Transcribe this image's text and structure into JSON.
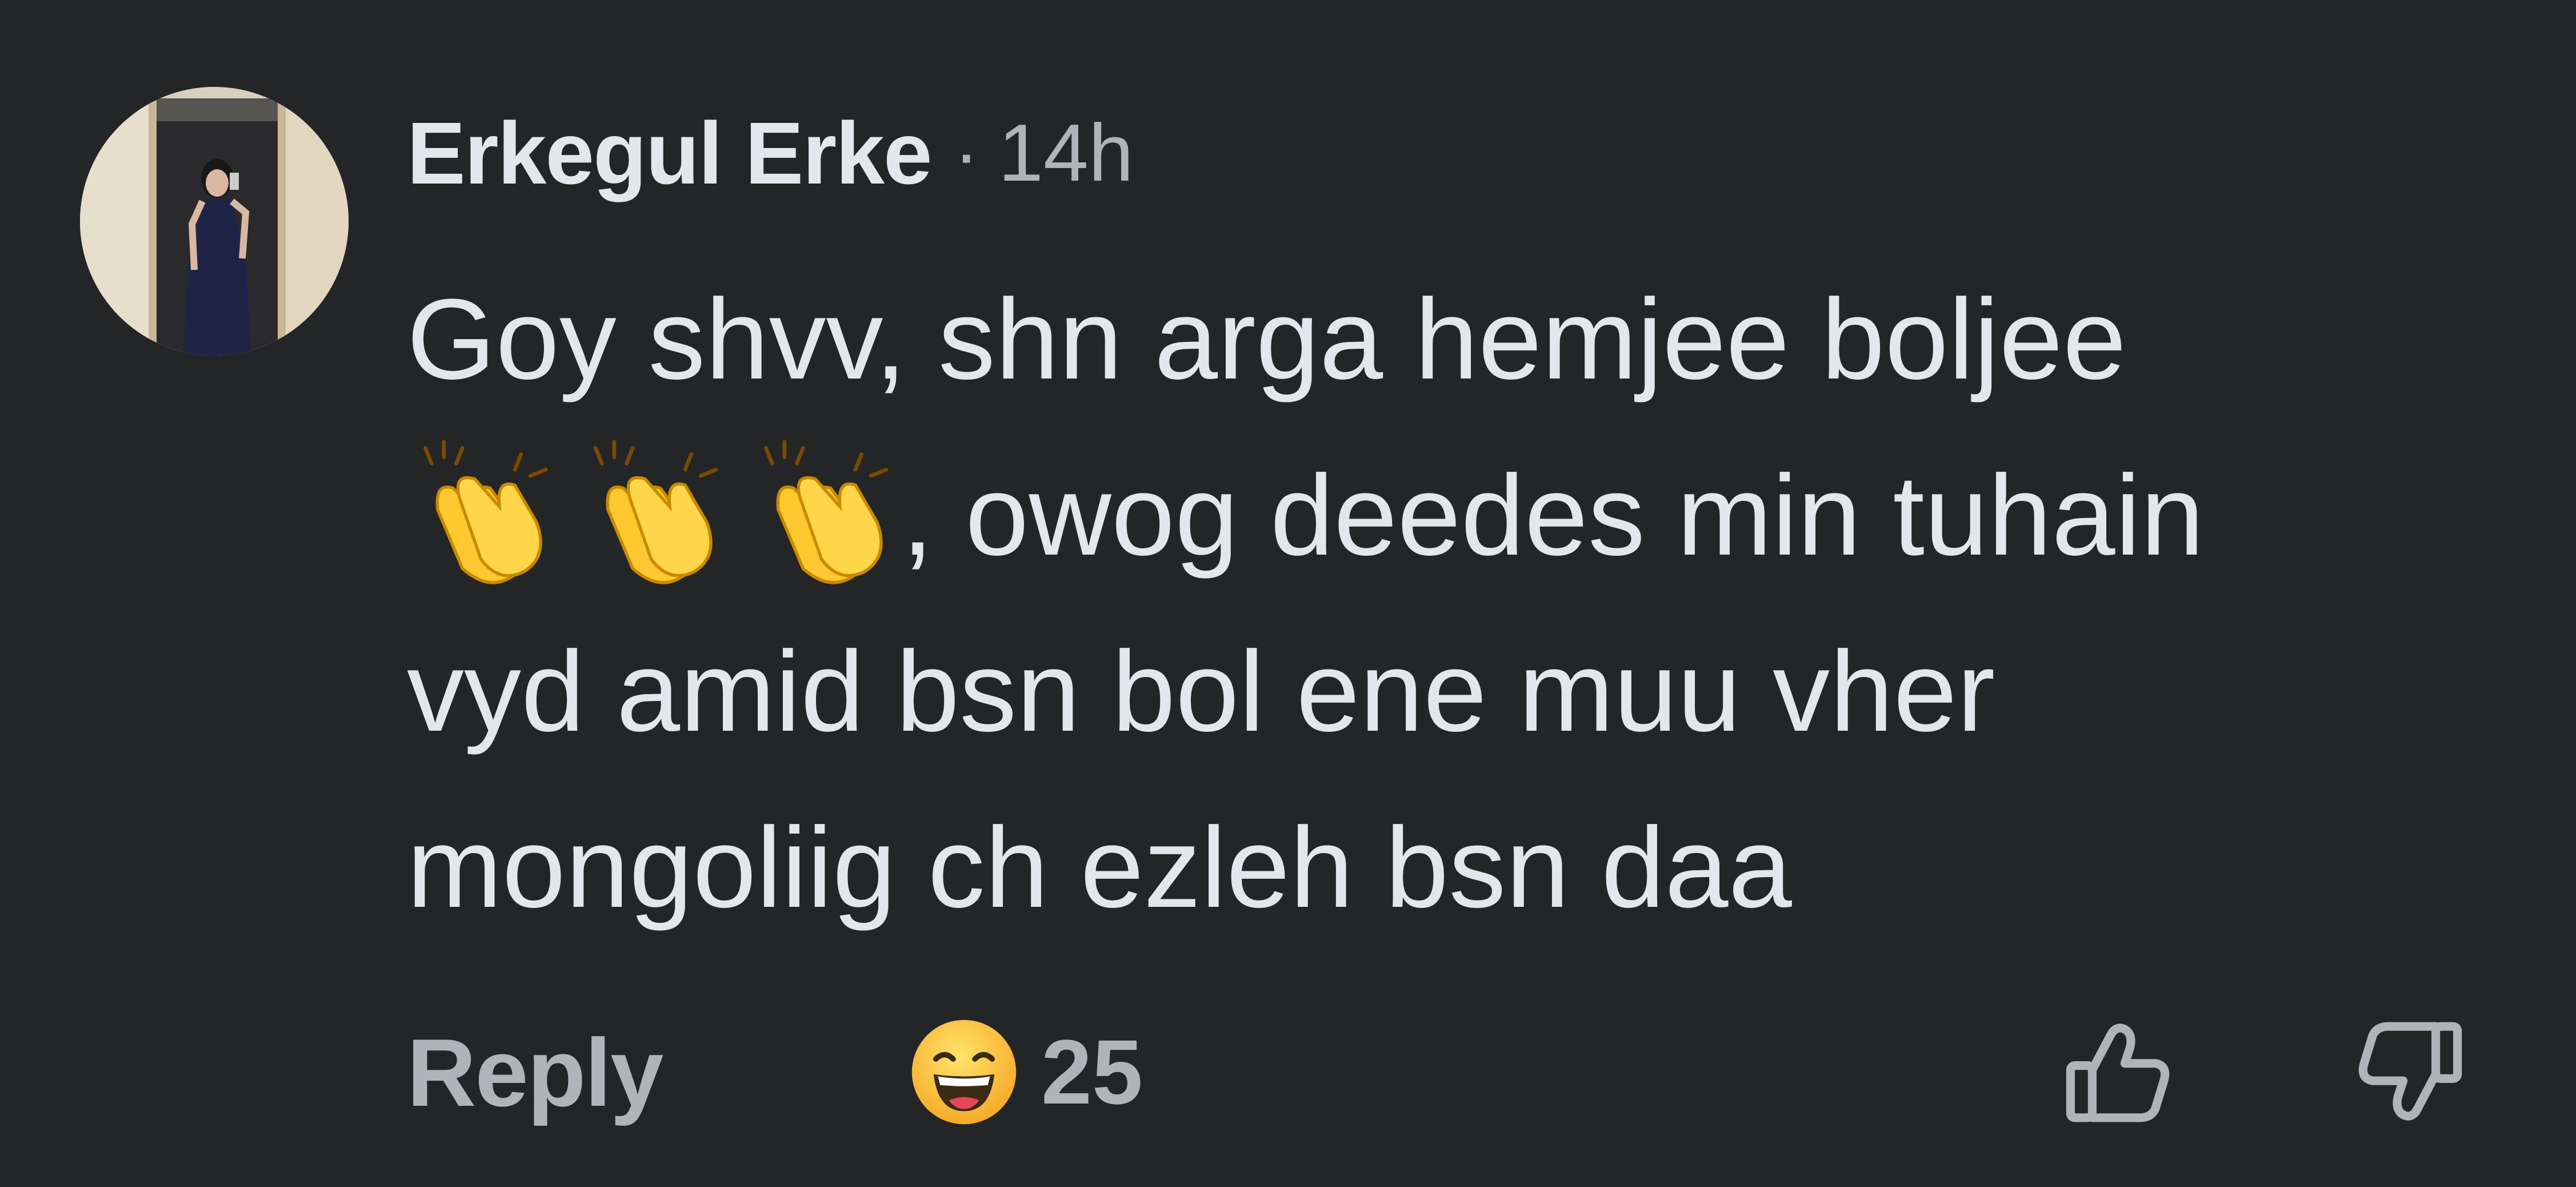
{
  "comment": {
    "author": "Erkegul Erke",
    "separator": "·",
    "time": "14h",
    "body_lines": [
      "Goy shvv, shn arga hemjee boljee",
      ", owog deedes min tuhain",
      "vyd amid bsn bol ene muu vher",
      "mongoliig ch ezleh bsn daa"
    ],
    "inline_emoji": [
      "clapping-hands",
      "clapping-hands",
      "clapping-hands"
    ]
  },
  "actions": {
    "reply_label": "Reply",
    "reaction_emoji": "grinning-squinting-face",
    "reaction_count": "25",
    "upvote_icon": "thumbs-up-outline-icon",
    "downvote_icon": "thumbs-down-outline-icon"
  },
  "colors": {
    "background": "#242527",
    "primary_text": "#e4e6eb",
    "secondary_text": "#b0b3b8",
    "emoji_yellow": "#fdc830"
  }
}
